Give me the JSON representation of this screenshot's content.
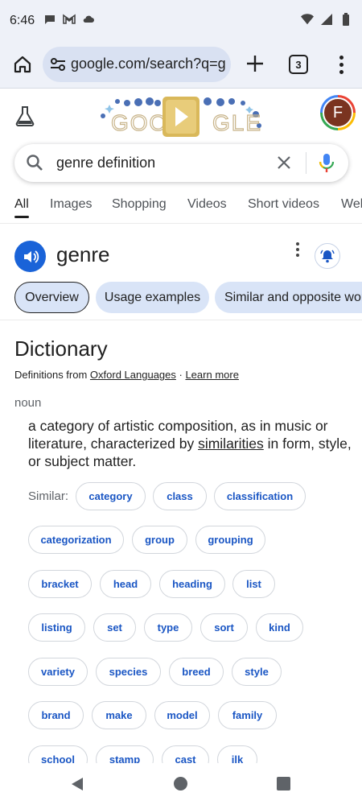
{
  "status_bar": {
    "time": "6:46"
  },
  "toolbar": {
    "url": "google.com/search?q=g",
    "tab_count": "3"
  },
  "header": {
    "avatar_initial": "F",
    "doodle_text": "GOOGLE"
  },
  "search": {
    "query": "genre definition"
  },
  "tabs": [
    "All",
    "Images",
    "Shopping",
    "Videos",
    "Short videos",
    "Web"
  ],
  "word_card": {
    "word": "genre"
  },
  "chips": [
    "Overview",
    "Usage examples",
    "Similar and opposite words"
  ],
  "dictionary": {
    "title": "Dictionary",
    "source_prefix": "Definitions from ",
    "source_name": "Oxford Languages",
    "source_sep": " · ",
    "learn_more": "Learn more",
    "part_of_speech": "noun",
    "definition_before": "a category of artistic composition, as in music or literature, characterized by ",
    "definition_link": "similarities",
    "definition_after": " in form, style, or subject matter.",
    "similar_label": "Similar:",
    "synonyms": [
      "category",
      "class",
      "classification",
      "categorization",
      "group",
      "grouping",
      "bracket",
      "head",
      "heading",
      "list",
      "listing",
      "set",
      "type",
      "sort",
      "kind",
      "variety",
      "species",
      "breed",
      "style",
      "brand",
      "make",
      "model",
      "family",
      "school",
      "stamp",
      "cast",
      "ilk"
    ]
  },
  "colors": {
    "accent": "#1a63d8",
    "chip_bg": "#d9e4f7",
    "link": "#1a56c4"
  }
}
